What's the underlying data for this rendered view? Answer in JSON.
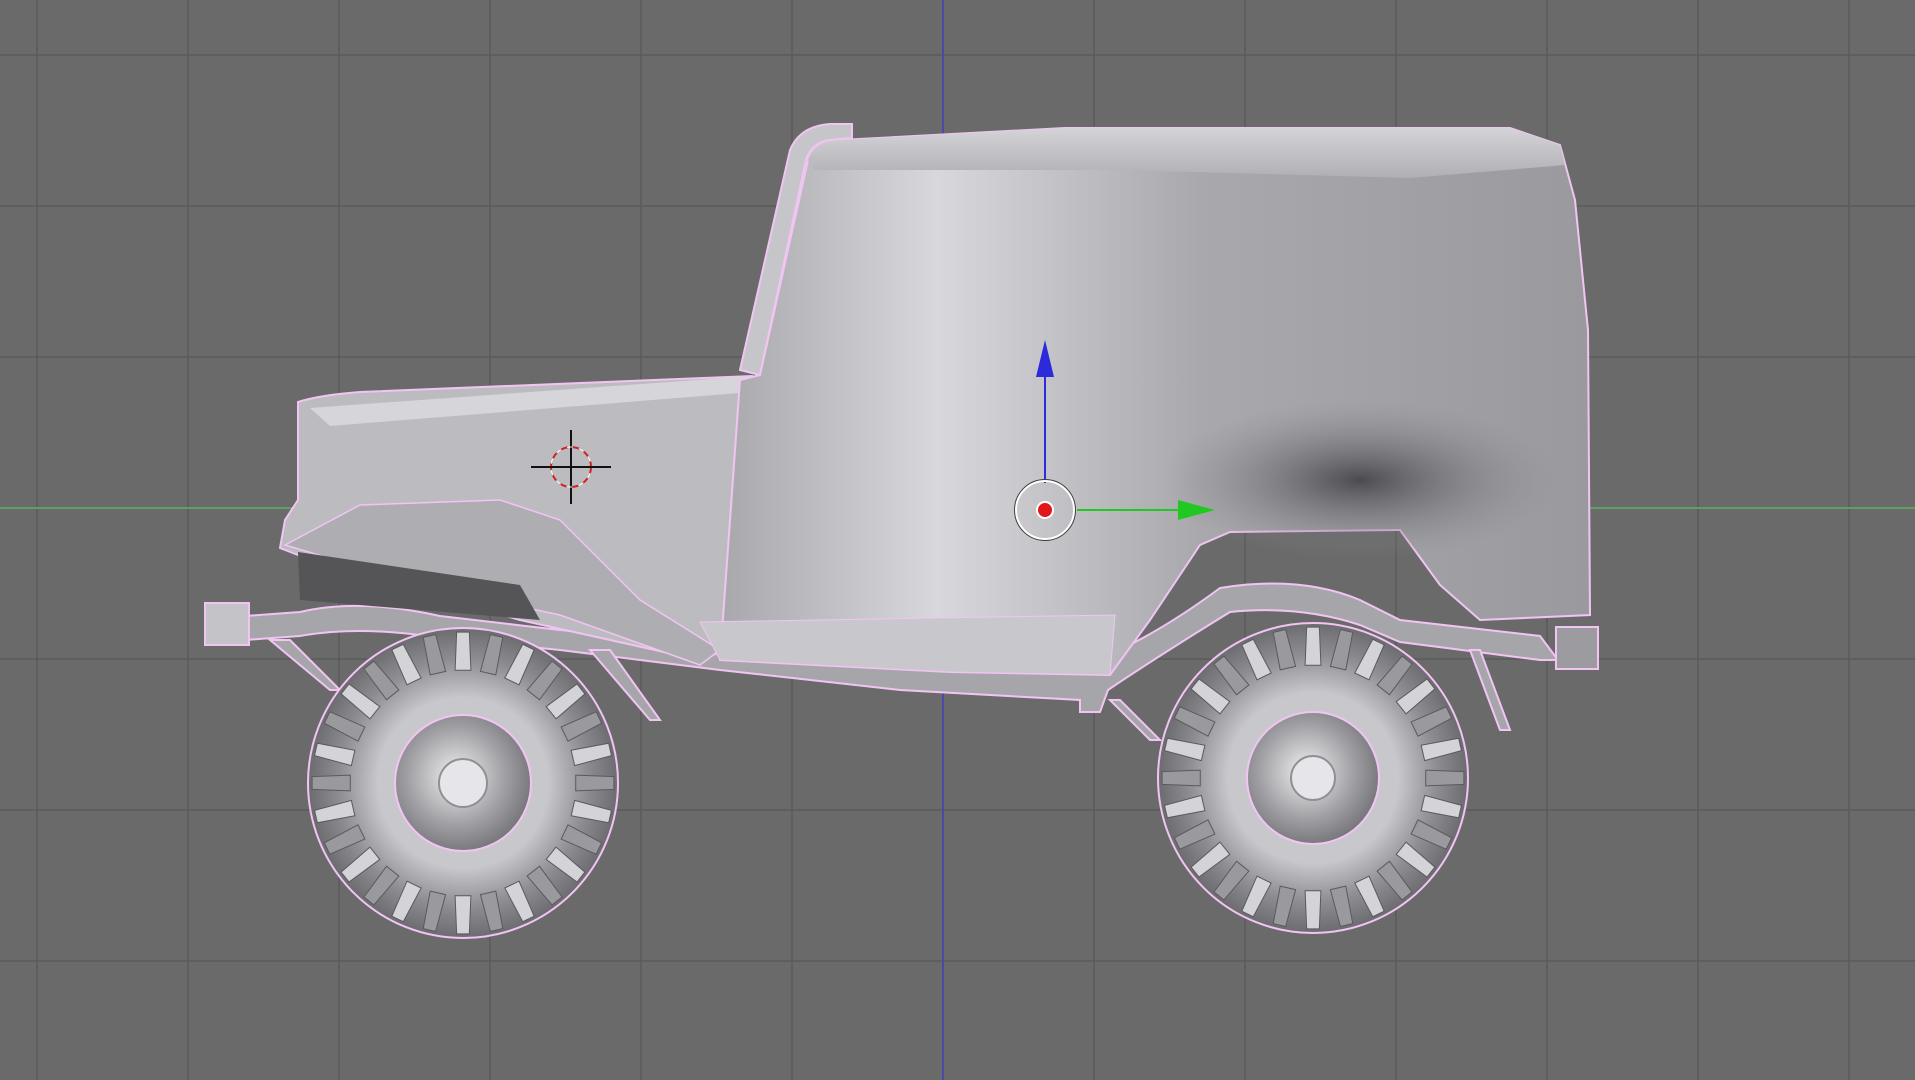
{
  "viewport": {
    "view": "side-orthographic",
    "background_color": "#6a6a6a",
    "grid_color": "#5a5a5a",
    "x_axis_color": "#5fa05f",
    "z_axis_color": "#4a4aa8",
    "selection_outline_color": "#f2c4f4"
  },
  "object": {
    "type": "mesh",
    "name_shown": "",
    "body_color": "#b8b8bc",
    "wheel_color": "#a4a4a8"
  },
  "gizmo": {
    "z_arrow_color": "#2b2bdc",
    "y_arrow_color": "#22c822",
    "origin_color": "#e01818"
  },
  "cursor_3d": {
    "icon": "crosshair-icon",
    "color": "#d02020"
  }
}
